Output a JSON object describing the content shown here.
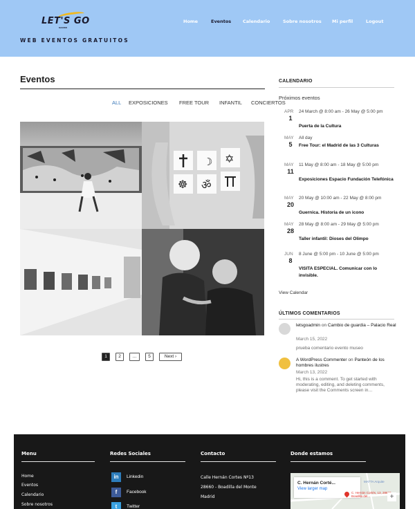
{
  "header": {
    "logo_text": "LET'S GO",
    "logo_sub": "MADRID",
    "tagline": "WEB EVENTOS GRATUITOS",
    "nav": [
      "Home",
      "Eventos",
      "Calendario",
      "Sobre nosotros",
      "Mi perfil",
      "Logout"
    ],
    "nav_active": "Eventos",
    "bg_color": "#9fc8f5"
  },
  "main": {
    "title": "Eventos",
    "filters": [
      "ALL",
      "EXPOSICIONES",
      "FREE TOUR",
      "INFANTIL",
      "CONCIERTOS"
    ],
    "filter_active": "ALL",
    "accent_color": "#3a78b8",
    "pagination": [
      "1",
      "2",
      "…",
      "5",
      "Next ›"
    ],
    "current_page": "1"
  },
  "sidebar": {
    "calendar_heading": "CALENDARIO",
    "upcoming_label": "Próximos eventos",
    "events": [
      {
        "month": "APR",
        "day": "1",
        "date": "24 March @ 8:00 am - 26 May @ 5:00 pm",
        "title": "Puerta de la Cultura"
      },
      {
        "month": "MAY",
        "day": "5",
        "date": "All day",
        "title": "Free Tour: el Madrid de las 3 Culturas"
      },
      {
        "month": "MAY",
        "day": "11",
        "date": "11 May @ 8:00 am - 18 May @ 5:00 pm",
        "title": "Exposiciones Espacio Fundación Telefónica"
      },
      {
        "month": "MAY",
        "day": "20",
        "date": "20 May @ 10:00 am - 22 May @ 8:00 pm",
        "title": "Guernica. Historia de un icono"
      },
      {
        "month": "MAY",
        "day": "28",
        "date": "28 May @ 8:00 am - 29 May @ 5:00 pm",
        "title": "Taller infantil: Dioses del Olimpo"
      },
      {
        "month": "JUN",
        "day": "8",
        "date": "8 June @ 5:00 pm - 10 June @ 5:00 pm",
        "title": "VISITA ESPECIAL. Comunicar con lo invisible."
      }
    ],
    "view_calendar": "View Calendar",
    "comments_heading": "ÚLTIMOS COMENTARIOS",
    "comments": [
      {
        "author": "letsgoadmin",
        "on": "on",
        "post": "Cambio de guardia – Palacio Real",
        "date": "March 15, 2022",
        "text": "prueba comentario evento museo"
      },
      {
        "author": "A WordPress Commenter",
        "on": "on",
        "post": "Panteón de los hombres ilustres",
        "date": "March 13, 2022",
        "text": "Hi, this is a comment. To get started with moderating, editing, and deleting comments, please visit the Comments screen in…"
      }
    ]
  },
  "footer": {
    "menu_heading": "Menu",
    "menu_links": [
      "Home",
      "Eventos",
      "Calendario",
      "Sobre nosotros"
    ],
    "social_heading": "Redes Sociales",
    "social": [
      {
        "icon": "linkedin-icon",
        "glyph": "in",
        "label": "Linkedin"
      },
      {
        "icon": "facebook-icon",
        "glyph": "f",
        "label": "Facebook"
      },
      {
        "icon": "twitter-icon",
        "glyph": "t",
        "label": "Twitter"
      }
    ],
    "contact_heading": "Contacto",
    "contact_lines": [
      "Calle Hernán Cortes Nº13",
      "28660 - Boadilla del Monte",
      "Madrid"
    ],
    "map_heading": "Donde estamos",
    "map_place": "C. Hernán Corté...",
    "map_link": "View larger map",
    "map_pin_label": "C. Hernán Cortés, 13, 28660 Boadilla del...",
    "map_poi": "MATTA Arquite",
    "map_zoom": "+"
  }
}
